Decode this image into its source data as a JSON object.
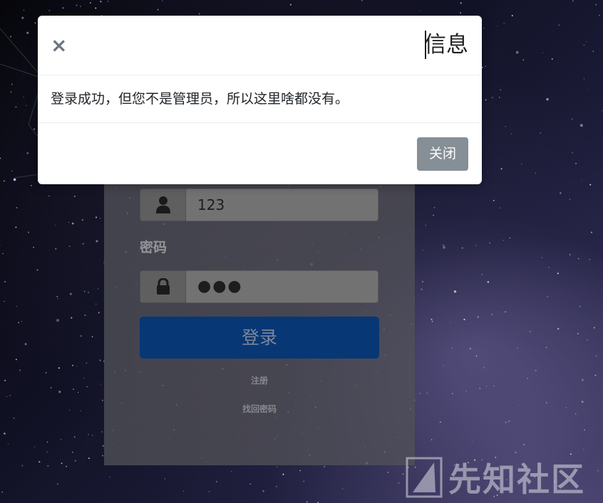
{
  "modal": {
    "title": "信息",
    "close_symbol": "×",
    "message": "登录成功，但您不是管理员，所以这里啥都没有。",
    "close_button_label": "关闭"
  },
  "login_form": {
    "username_value": "123",
    "username_icon": "user-icon",
    "password_label": "密码",
    "password_value": "●●●",
    "password_icon": "lock-icon",
    "submit_label": "登录",
    "register_link": "注册",
    "forgot_password_link": "找回密码"
  },
  "watermark": {
    "text": "先知社区"
  },
  "colors": {
    "primary_button": "#0a3f86",
    "secondary_button": "#868e96",
    "modal_background": "#ffffff"
  }
}
